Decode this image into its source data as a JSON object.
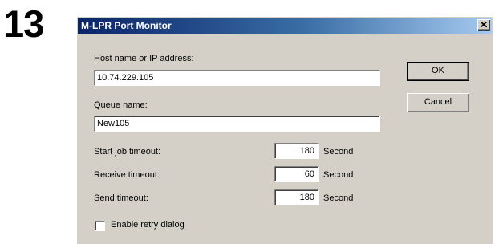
{
  "step": {
    "number": "13"
  },
  "dialog": {
    "title": "M-LPR Port Monitor",
    "close_icon": "close-x-icon"
  },
  "form": {
    "host_label": "Host name or IP address:",
    "host_value": "10.74.229.105",
    "queue_label": "Queue name:",
    "queue_value": "New105",
    "start_job_label": "Start job timeout:",
    "start_job_value": "180",
    "receive_label": "Receive timeout:",
    "receive_value": "60",
    "send_label": "Send timeout:",
    "send_value": "180",
    "unit": "Second",
    "retry_label": "Enable retry dialog",
    "retry_checked": false
  },
  "buttons": {
    "ok": "OK",
    "cancel": "Cancel"
  }
}
